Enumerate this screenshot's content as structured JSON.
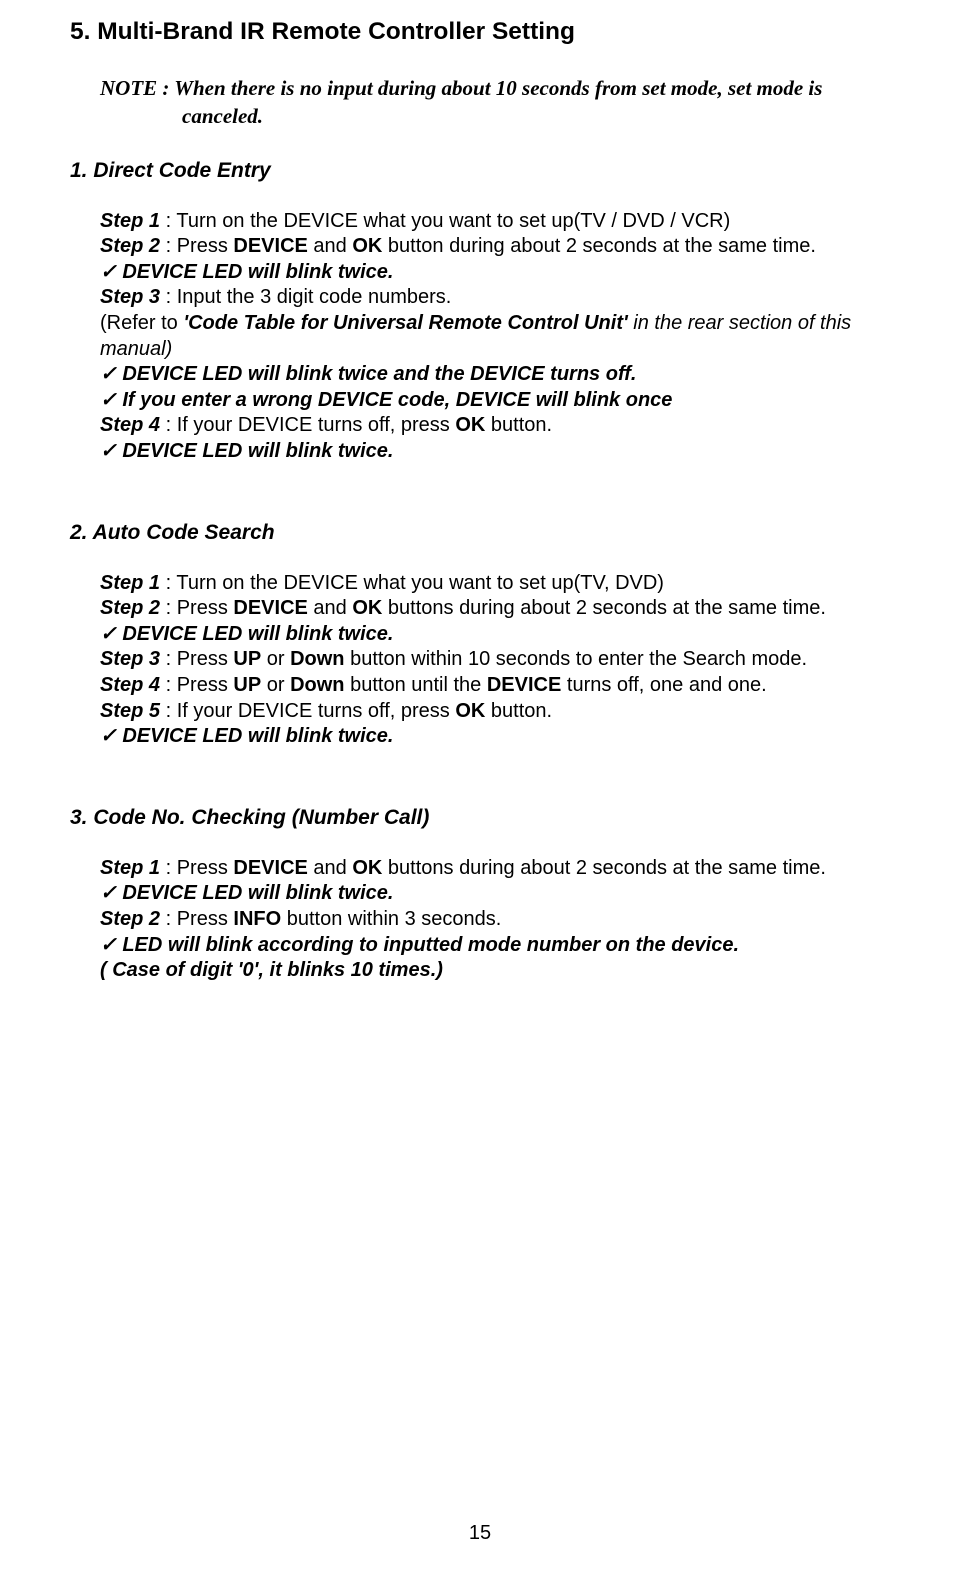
{
  "title": "5. Multi-Brand IR Remote Controller Setting",
  "note_line1": "NOTE : When there is no input during about 10 seconds from set mode, set mode is",
  "note_line2": "canceled.",
  "s1": {
    "heading": "1.   Direct Code Entry",
    "step1_label": "Step 1",
    "step1_text": " : Turn on the DEVICE what you want to set up(TV / DVD / VCR)",
    "step2_label": "Step 2",
    "step2_text_a": " : Press ",
    "step2_text_b": "DEVICE",
    "step2_text_c": " and ",
    "step2_text_d": "OK",
    "step2_text_e": " button during about 2 seconds at the same time.",
    "check1": "✓ DEVICE LED will blink twice.",
    "step3_label": "Step 3",
    "step3_text": " : Input the 3 digit code numbers.",
    "refer_a": "(Refer to ",
    "refer_b": "'Code Table for Universal Remote Control Unit'",
    "refer_c": " in the rear section of this manual)",
    "check2": "✓ DEVICE LED will blink twice and the DEVICE turns off.",
    "check3": "✓ If you enter a wrong DEVICE code, DEVICE will blink once",
    "step4_label": "Step 4",
    "step4_text_a": " : If your DEVICE turns off, press ",
    "step4_text_b": "OK",
    "step4_text_c": " button.",
    "check4": "✓ DEVICE LED will blink twice."
  },
  "s2": {
    "heading": "2.   Auto Code Search",
    "step1_label": "Step 1",
    "step1_text": " : Turn on the DEVICE what you want to set up(TV, DVD)",
    "step2_label": "Step 2",
    "step2_a": " : Press ",
    "step2_b": "DEVICE",
    "step2_c": " and ",
    "step2_d": "OK",
    "step2_e": " buttons during about 2 seconds at the same time.",
    "check1": "✓ DEVICE LED will blink twice.",
    "step3_label": "Step 3",
    "step3_a": " : Press ",
    "step3_b": "UP",
    "step3_c": " or ",
    "step3_d": "Down",
    "step3_e": " button within 10 seconds to enter the Search mode.",
    "step4_label": "Step 4",
    "step4_a": " : Press ",
    "step4_b": "UP",
    "step4_c": " or ",
    "step4_d": "Down",
    "step4_e": " button until the ",
    "step4_f": "DEVICE",
    "step4_g": " turns off, one and one.",
    "step5_label": "Step 5",
    "step5_a": " : If your DEVICE turns off, press ",
    "step5_b": "OK",
    "step5_c": " button.",
    "check2": "✓ DEVICE LED will blink twice."
  },
  "s3": {
    "heading": "3.   Code No. Checking (Number Call)",
    "step1_label": "Step 1",
    "step1_a": " : Press ",
    "step1_b": "DEVICE",
    "step1_c": " and ",
    "step1_d": "OK",
    "step1_e": " buttons during about 2 seconds at the same time.",
    "check1": "✓ DEVICE LED will blink twice.",
    "step2_label": "Step 2",
    "step2_a": " : Press ",
    "step2_b": "INFO",
    "step2_c": " button within 3 seconds.",
    "check2": "✓ LED will blink according to inputted mode number on the device.",
    "check2b": "( Case of digit '0', it blinks 10 times.)"
  },
  "page_number": "15"
}
